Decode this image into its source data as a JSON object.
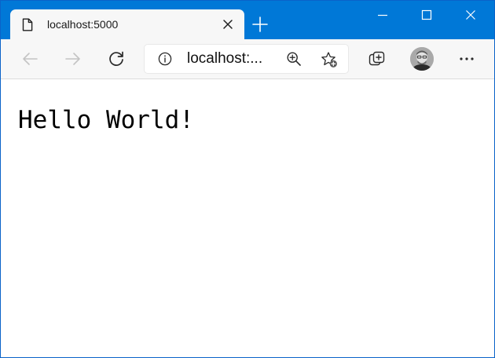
{
  "tab": {
    "title": "localhost:5000",
    "icon": "page-icon"
  },
  "address_bar": {
    "url": "localhost:..."
  },
  "page": {
    "text": "Hello World!"
  },
  "colors": {
    "title_bar": "#0078d7",
    "tab": "#f7f7f7",
    "toolbar": "#f7f7f7"
  },
  "icons": {
    "tab_close": "close-icon",
    "new_tab": "plus-icon",
    "window": [
      "minimize-icon",
      "maximize-icon",
      "close-icon"
    ],
    "navigation": [
      "back-arrow-icon",
      "forward-arrow-icon",
      "refresh-icon"
    ],
    "address": [
      "info-icon",
      "zoom-icon",
      "add-favorite-icon"
    ],
    "toolbar_right": [
      "collections-icon",
      "profile-avatar",
      "more-options-icon"
    ]
  }
}
